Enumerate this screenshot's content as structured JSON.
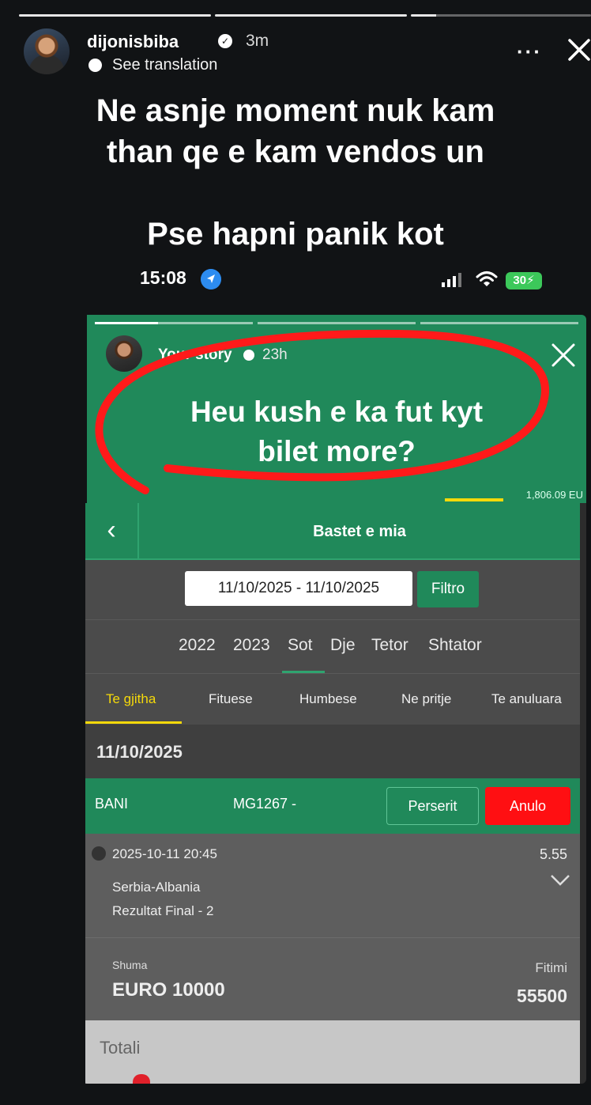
{
  "story": {
    "username": "dijonisbiba",
    "age": "3m",
    "translation_label": "See translation",
    "caption_line1": "Ne asnje moment nuk kam",
    "caption_line2": "than qe e kam vendos un",
    "caption_line3": "Pse hapni panik kot"
  },
  "inner_status": {
    "time": "15:08",
    "battery": "30"
  },
  "reshared_story": {
    "username": "Your story",
    "age": "23h",
    "caption_line1": "Heu kush e ka fut kyt",
    "caption_line2": "bilet more?",
    "balance": "1,806.09 EU"
  },
  "app": {
    "nav_title": "Bastet e mia",
    "date_range": "11/10/2025 - 11/10/2025",
    "filter_label": "Filtro",
    "years": [
      "2022",
      "2023",
      "Sot",
      "Dje",
      "Tetor",
      "Shtator"
    ],
    "tabs": [
      "Te gjitha",
      "Fituese",
      "Humbese",
      "Ne pritje",
      "Te anuluara"
    ],
    "date_header": "11/10/2025",
    "bet": {
      "type": "BANI",
      "code": "MG1267 -",
      "repeat_label": "Perserit",
      "cancel_label": "Anulo",
      "datetime": "2025-10-11 20:45",
      "odds": "5.55",
      "match": "Serbia-Albania",
      "market": "Rezultat Final - 2",
      "stake_label": "Shuma",
      "stake_value": "EURO 10000",
      "win_label": "Fitimi",
      "win_value": "55500"
    },
    "totals_label": "Totali"
  },
  "colors": {
    "green": "#20895a",
    "accent_yellow": "#f5d90a",
    "cancel_red": "#ff0f12",
    "marker_red": "#ff1a1a"
  }
}
